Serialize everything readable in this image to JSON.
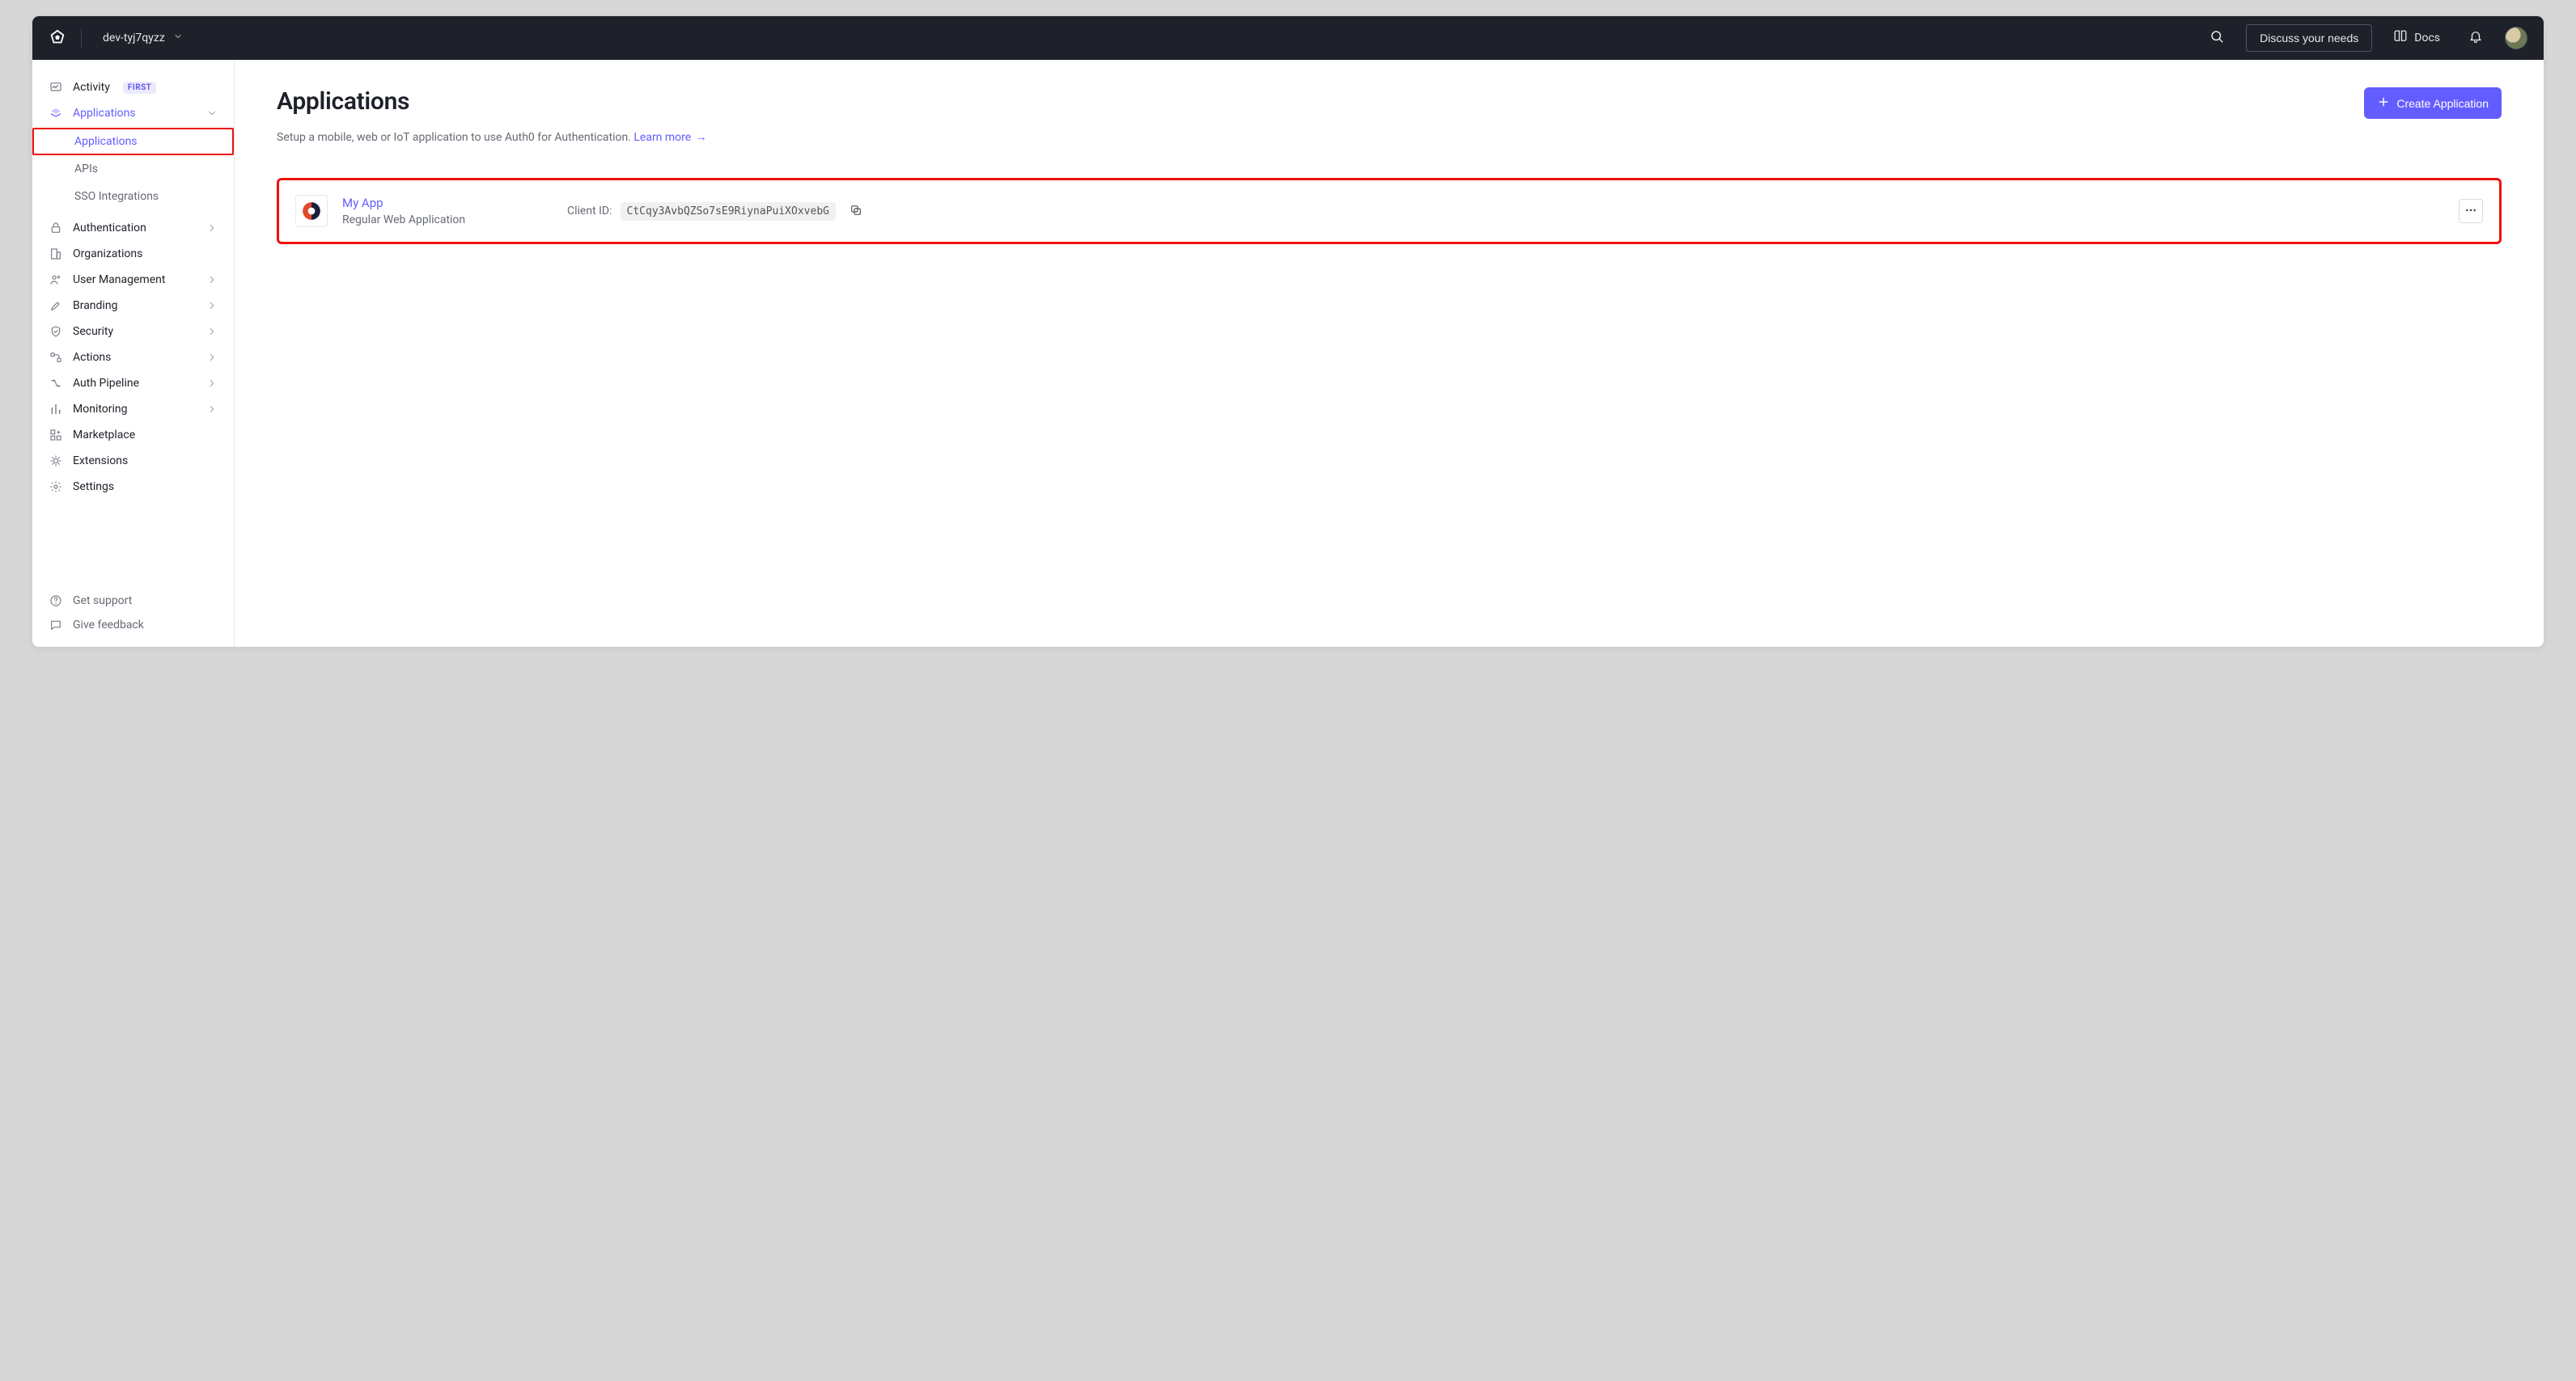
{
  "topbar": {
    "tenant_name": "dev-tyj7qyzz",
    "discuss_label": "Discuss your needs",
    "docs_label": "Docs"
  },
  "sidebar": {
    "items": [
      {
        "key": "activity",
        "label": "Activity",
        "badge": "FIRST"
      },
      {
        "key": "applications",
        "label": "Applications",
        "expanded": true,
        "children": [
          {
            "key": "applications",
            "label": "Applications",
            "selected": true,
            "highlight": true
          },
          {
            "key": "apis",
            "label": "APIs"
          },
          {
            "key": "sso",
            "label": "SSO Integrations"
          }
        ]
      },
      {
        "key": "authentication",
        "label": "Authentication",
        "has_children": true
      },
      {
        "key": "organizations",
        "label": "Organizations"
      },
      {
        "key": "user_management",
        "label": "User Management",
        "has_children": true
      },
      {
        "key": "branding",
        "label": "Branding",
        "has_children": true
      },
      {
        "key": "security",
        "label": "Security",
        "has_children": true
      },
      {
        "key": "actions",
        "label": "Actions",
        "has_children": true
      },
      {
        "key": "auth_pipeline",
        "label": "Auth Pipeline",
        "has_children": true
      },
      {
        "key": "monitoring",
        "label": "Monitoring",
        "has_children": true
      },
      {
        "key": "marketplace",
        "label": "Marketplace"
      },
      {
        "key": "extensions",
        "label": "Extensions"
      },
      {
        "key": "settings",
        "label": "Settings"
      }
    ],
    "footer": {
      "support_label": "Get support",
      "feedback_label": "Give feedback"
    }
  },
  "main": {
    "title": "Applications",
    "description": "Setup a mobile, web or IoT application to use Auth0 for Authentication. ",
    "learn_more_label": "Learn more",
    "create_label": "Create Application",
    "app": {
      "name": "My App",
      "type": "Regular Web Application",
      "client_id_label": "Client ID:",
      "client_id": "CtCqy3AvbQZSo7sE9RiynaPuiXOxvebG"
    }
  }
}
